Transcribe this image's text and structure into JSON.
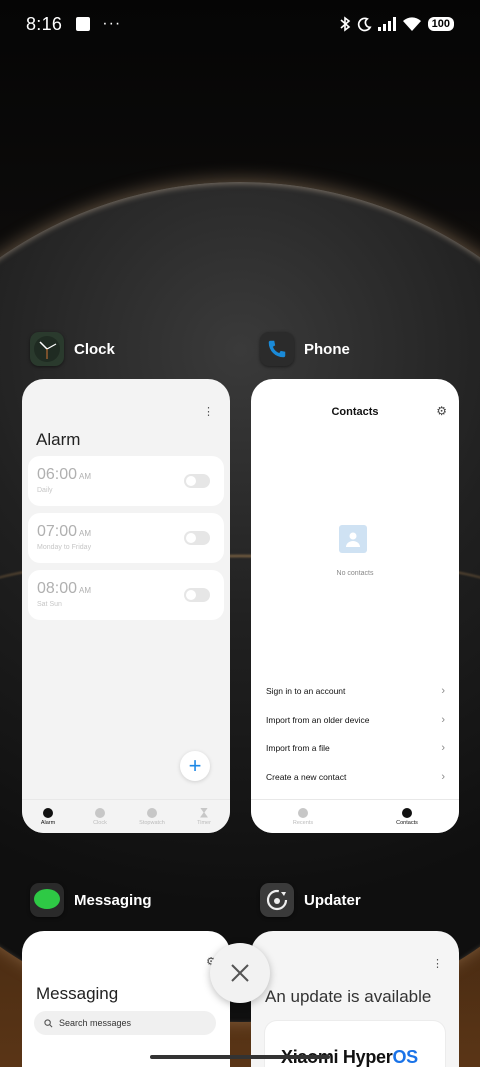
{
  "status_bar": {
    "time": "8:16",
    "overflow": "···",
    "battery": "100",
    "icons": [
      "notification-square-icon",
      "bluetooth-icon",
      "moon-icon",
      "signal-icon",
      "wifi-icon",
      "battery-icon"
    ]
  },
  "apps": {
    "clock": {
      "name": "Clock",
      "menu_glyph": "⋮",
      "title": "Alarm",
      "alarms": [
        {
          "time": "06:00",
          "ampm": "AM",
          "repeat": "Daily",
          "enabled": false
        },
        {
          "time": "07:00",
          "ampm": "AM",
          "repeat": "Monday to Friday",
          "enabled": false
        },
        {
          "time": "08:00",
          "ampm": "AM",
          "repeat": "Sat Sun",
          "enabled": false
        }
      ],
      "fab": "+",
      "nav": [
        "Alarm",
        "Clock",
        "Stopwatch",
        "Timer"
      ],
      "nav_active": "Alarm"
    },
    "phone": {
      "name": "Phone",
      "title": "Contacts",
      "empty_text": "No contacts",
      "menu": [
        "Sign in to an account",
        "Import from an older device",
        "Import from a file",
        "Create a new contact"
      ],
      "nav": [
        "Recents",
        "Contacts"
      ],
      "nav_active": "Contacts"
    },
    "messaging": {
      "name": "Messaging",
      "title": "Messaging",
      "search_placeholder": "Search messages"
    },
    "updater": {
      "name": "Updater",
      "menu_glyph": "⋮",
      "title": "An update is available",
      "brand_prefix": "Xiaomi Hyper",
      "brand_suffix": "OS"
    }
  },
  "colors": {
    "accent": "#1e88e5",
    "messaging_green": "#2ec945",
    "phone_blue": "#1a8ad8"
  }
}
